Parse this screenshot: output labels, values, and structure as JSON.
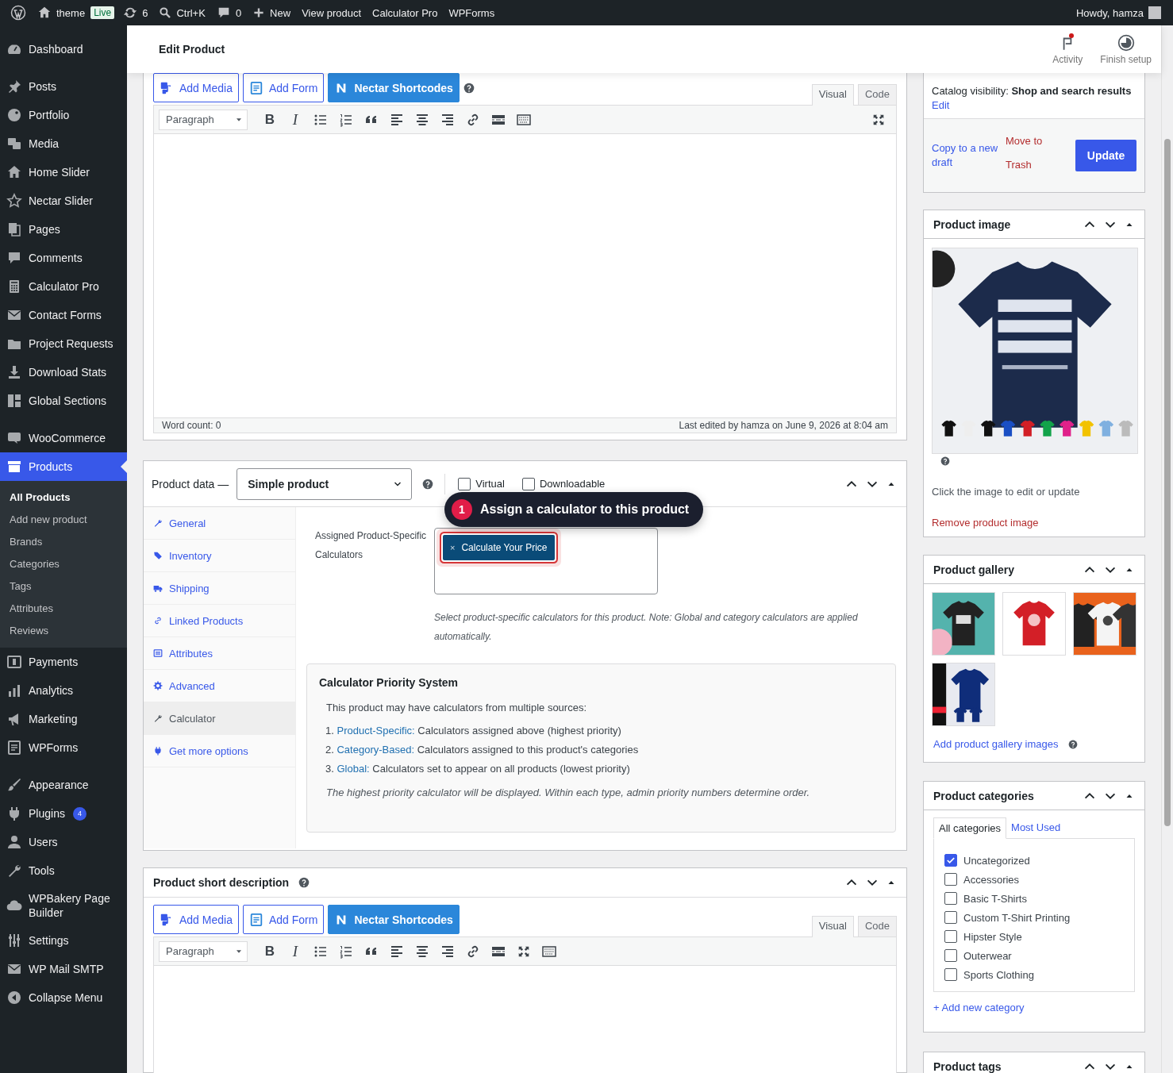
{
  "admin_bar": {
    "site": "theme",
    "live_badge": "Live",
    "updates": "6",
    "search": "Ctrl+K",
    "comments": "0",
    "new": "New",
    "links": [
      "View product",
      "Calculator Pro",
      "WPForms"
    ],
    "greeting": "Howdy, hamza"
  },
  "menu": [
    {
      "items": [
        {
          "label": "Dashboard",
          "selected": false
        }
      ]
    },
    {
      "items": [
        {
          "label": "Posts",
          "selected": false
        },
        {
          "label": "Portfolio",
          "selected": false
        },
        {
          "label": "Media",
          "selected": false
        },
        {
          "label": "Home Slider",
          "selected": false
        },
        {
          "label": "Nectar Slider",
          "selected": false
        },
        {
          "label": "Pages",
          "selected": false
        },
        {
          "label": "Comments",
          "selected": false
        },
        {
          "label": "Calculator Pro",
          "selected": false
        },
        {
          "label": "Contact Forms",
          "selected": false
        },
        {
          "label": "Project Requests",
          "selected": false
        },
        {
          "label": "Download Stats",
          "selected": false
        },
        {
          "label": "Global Sections",
          "selected": false
        }
      ]
    },
    {
      "items": [
        {
          "label": "WooCommerce",
          "selected": false
        },
        {
          "label": "Products",
          "selected": true,
          "children": [
            {
              "label": "All Products",
              "selected": true
            },
            {
              "label": "Add new product",
              "selected": false
            },
            {
              "label": "Brands",
              "selected": false
            },
            {
              "label": "Categories",
              "selected": false
            },
            {
              "label": "Tags",
              "selected": false
            },
            {
              "label": "Attributes",
              "selected": false
            },
            {
              "label": "Reviews",
              "selected": false
            }
          ]
        },
        {
          "label": "Payments",
          "selected": false
        },
        {
          "label": "Analytics",
          "selected": false
        },
        {
          "label": "Marketing",
          "selected": false
        },
        {
          "label": "WPForms",
          "selected": false
        }
      ]
    },
    {
      "items": [
        {
          "label": "Appearance",
          "selected": false
        },
        {
          "label": "Plugins",
          "selected": false,
          "badge": "4"
        },
        {
          "label": "Users",
          "selected": false
        },
        {
          "label": "Tools",
          "selected": false
        },
        {
          "label": "WPBakery Page Builder",
          "selected": false
        },
        {
          "label": "Settings",
          "selected": false
        },
        {
          "label": "WP Mail SMTP",
          "selected": false
        },
        {
          "label": "Collapse Menu",
          "selected": false
        }
      ]
    }
  ],
  "header": {
    "title": "Edit Product",
    "actions": [
      {
        "label": "Activity",
        "has_dot": true
      },
      {
        "label": "Finish setup",
        "has_dot": false
      }
    ]
  },
  "description_editor": {
    "buttons": [
      "Add Media",
      "Add Form",
      "Nectar Shortcodes"
    ],
    "tabs": [
      {
        "label": "Visual",
        "selected": true
      },
      {
        "label": "Code",
        "selected": false
      }
    ],
    "format": "Paragraph",
    "bold": "B",
    "italic": "I",
    "word_count": "Word count: 0",
    "last_edited": "Last edited by hamza on June 9, 2026 at 8:04 am"
  },
  "product_data": {
    "title": "Product data —",
    "type": "Simple product",
    "checkboxes": [
      {
        "label": "Virtual",
        "checked": false
      },
      {
        "label": "Downloadable",
        "checked": false
      }
    ],
    "tabs": [
      {
        "label": "General",
        "selected": false
      },
      {
        "label": "Inventory",
        "selected": false
      },
      {
        "label": "Shipping",
        "selected": false
      },
      {
        "label": "Linked Products",
        "selected": false
      },
      {
        "label": "Attributes",
        "selected": false
      },
      {
        "label": "Advanced",
        "selected": false
      },
      {
        "label": "Calculator",
        "selected": true
      },
      {
        "label": "Get more options",
        "selected": false
      }
    ],
    "field_label": "Assigned Product-Specific Calculators",
    "tags": [
      {
        "remove": "×",
        "label": "Calculate Your Price"
      }
    ],
    "help": "Select product-specific calculators for this product. Note: Global and category calculators are applied automatically.",
    "priority": {
      "title": "Calculator Priority System",
      "intro": "This product may have calculators from multiple sources:",
      "items": [
        {
          "number": "1.",
          "term": "Product-Specific:",
          "text": "Calculators assigned above (highest priority)"
        },
        {
          "number": "2.",
          "term": "Category-Based:",
          "text": "Calculators assigned to this product's categories"
        },
        {
          "number": "3.",
          "term": "Global:",
          "text": "Calculators set to appear on all products (lowest priority)"
        }
      ],
      "note": "The highest priority calculator will be displayed. Within each type, admin priority numbers determine order."
    }
  },
  "tour_tooltip": {
    "step": "1",
    "text": "Assign a calculator to this product"
  },
  "short_description": {
    "title": "Product short description",
    "buttons": [
      "Add Media",
      "Add Form",
      "Nectar Shortcodes"
    ],
    "tabs": [
      {
        "label": "Visual",
        "selected": true
      },
      {
        "label": "Code",
        "selected": false
      }
    ],
    "format": "Paragraph",
    "bold": "B",
    "italic": "I"
  },
  "publish": {
    "visibility": "Catalog visibility: **Shop and search results**",
    "edit": "Edit",
    "copy": "Copy to a new draft",
    "trash": "Move to Trash",
    "update": "Update"
  },
  "product_image": {
    "title": "Product image",
    "caption": "Click the image to edit or update",
    "remove": "Remove product image"
  },
  "product_gallery": {
    "title": "Product gallery",
    "add": "Add product gallery images"
  },
  "product_categories": {
    "title": "Product categories",
    "tabs": [
      {
        "label": "All categories",
        "selected": true
      },
      {
        "label": "Most Used",
        "selected": false
      }
    ],
    "items": [
      {
        "label": "Uncategorized",
        "checked": true
      },
      {
        "label": "Accessories",
        "checked": false
      },
      {
        "label": "Basic T-Shirts",
        "checked": false
      },
      {
        "label": "Custom T-Shirt Printing",
        "checked": false
      },
      {
        "label": "Hipster Style",
        "checked": false
      },
      {
        "label": "Outerwear",
        "checked": false
      },
      {
        "label": "Sports Clothing",
        "checked": false
      }
    ],
    "add": "+ Add new category"
  },
  "product_tags": {
    "title": "Product tags"
  }
}
